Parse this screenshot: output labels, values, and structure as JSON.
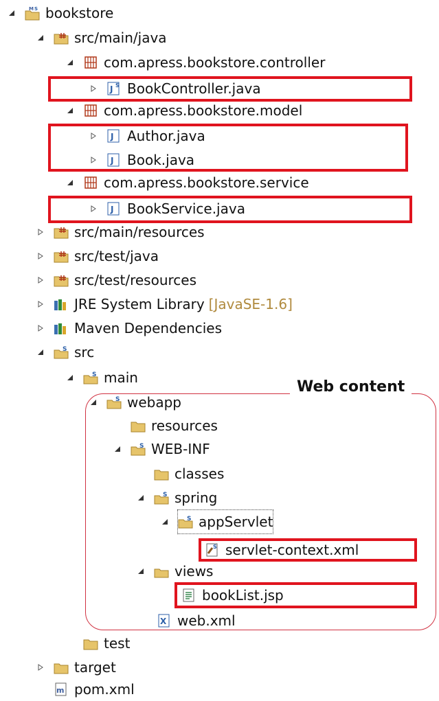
{
  "tree": {
    "project": "bookstore",
    "src_main_java": "src/main/java",
    "pkg_controller": "com.apress.bookstore.controller",
    "file_bookcontroller": "BookController.java",
    "pkg_model": "com.apress.bookstore.model",
    "file_author": "Author.java",
    "file_book": "Book.java",
    "pkg_service": "com.apress.bookstore.service",
    "file_bookservice": "BookService.java",
    "src_main_resources": "src/main/resources",
    "src_test_java": "src/test/java",
    "src_test_resources": "src/test/resources",
    "jre_library": "JRE System Library",
    "jre_version": "[JavaSE-1.6]",
    "maven_deps": "Maven Dependencies",
    "src": "src",
    "main": "main",
    "webapp": "webapp",
    "resources": "resources",
    "web_inf": "WEB-INF",
    "classes": "classes",
    "spring": "spring",
    "app_servlet": "appServlet",
    "servlet_context": "servlet-context.xml",
    "views": "views",
    "booklist": "bookList.jsp",
    "web_xml": "web.xml",
    "test": "test",
    "target": "target",
    "pom": "pom.xml"
  },
  "annotation": {
    "web_content": "Web content"
  },
  "colors": {
    "highlight": "#e0141e",
    "annotation_border": "#d03040",
    "folder": "#e6c46a",
    "package": "#b0381a",
    "java": "#2c5fa8",
    "jre_suffix": "#b08a3e"
  }
}
